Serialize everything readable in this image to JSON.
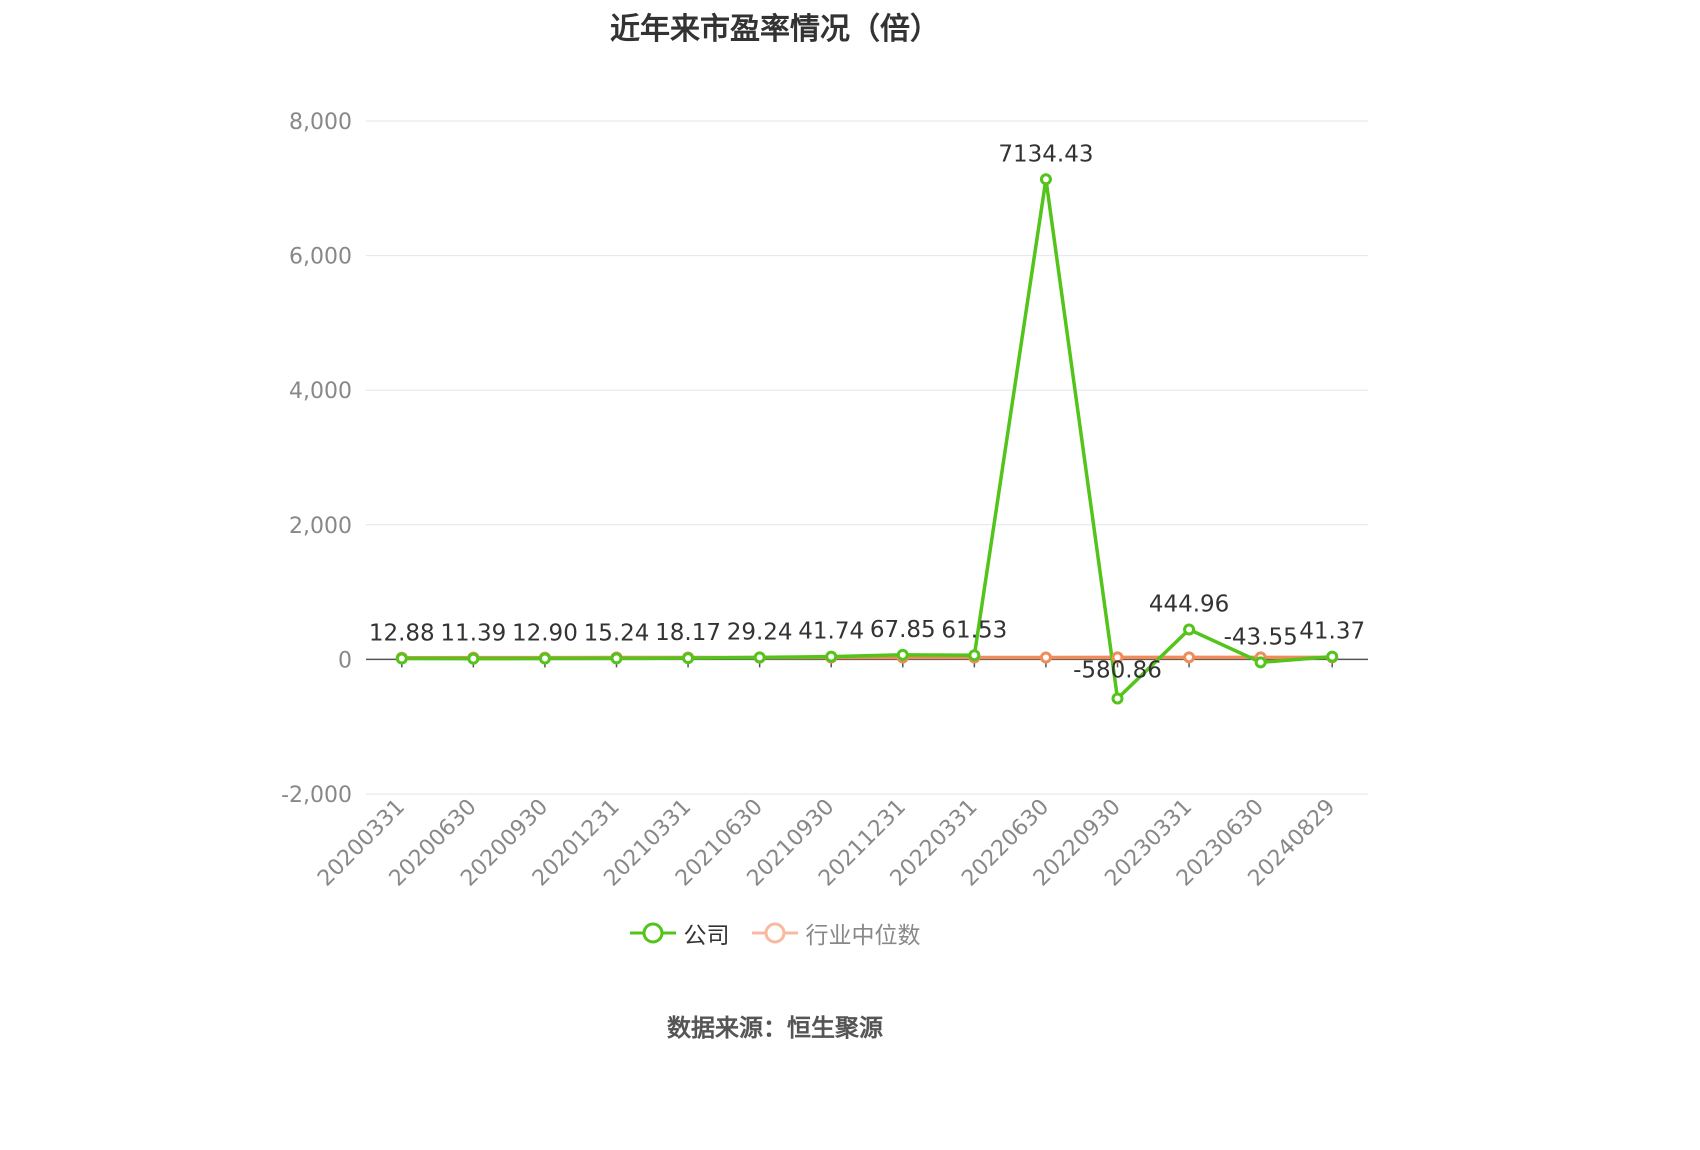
{
  "chart_data": {
    "type": "line",
    "title": "近年来市盈率情况（倍）",
    "categories": [
      "20200331",
      "20200630",
      "20200930",
      "20201231",
      "20210331",
      "20210630",
      "20210930",
      "20211231",
      "20220331",
      "20220630",
      "20220930",
      "20230331",
      "20230630",
      "20240829"
    ],
    "series": [
      {
        "name": "公司",
        "color": "#52c41a",
        "values": [
          12.88,
          11.39,
          12.9,
          15.24,
          18.17,
          29.24,
          41.74,
          67.85,
          61.53,
          7134.43,
          -580.86,
          444.96,
          -43.55,
          41.37
        ],
        "labels": [
          "12.88",
          "11.39",
          "12.90",
          "15.24",
          "18.17",
          "29.24",
          "41.74",
          "67.85",
          "61.53",
          "7134.43",
          "-580.86",
          "444.96",
          "-43.55",
          "41.37"
        ]
      },
      {
        "name": "行业中位数",
        "color": "#f08c5a",
        "values": [
          25,
          26,
          27,
          28,
          28,
          27,
          28,
          29,
          29,
          29,
          30,
          31,
          31,
          30
        ]
      }
    ],
    "yticks": [
      "8,000",
      "6,000",
      "4,000",
      "2,000",
      "0",
      "-2,000"
    ],
    "ylim": [
      -2000,
      8000
    ],
    "grid": true,
    "legend_position": "bottom"
  },
  "source": "数据来源：恒生聚源"
}
